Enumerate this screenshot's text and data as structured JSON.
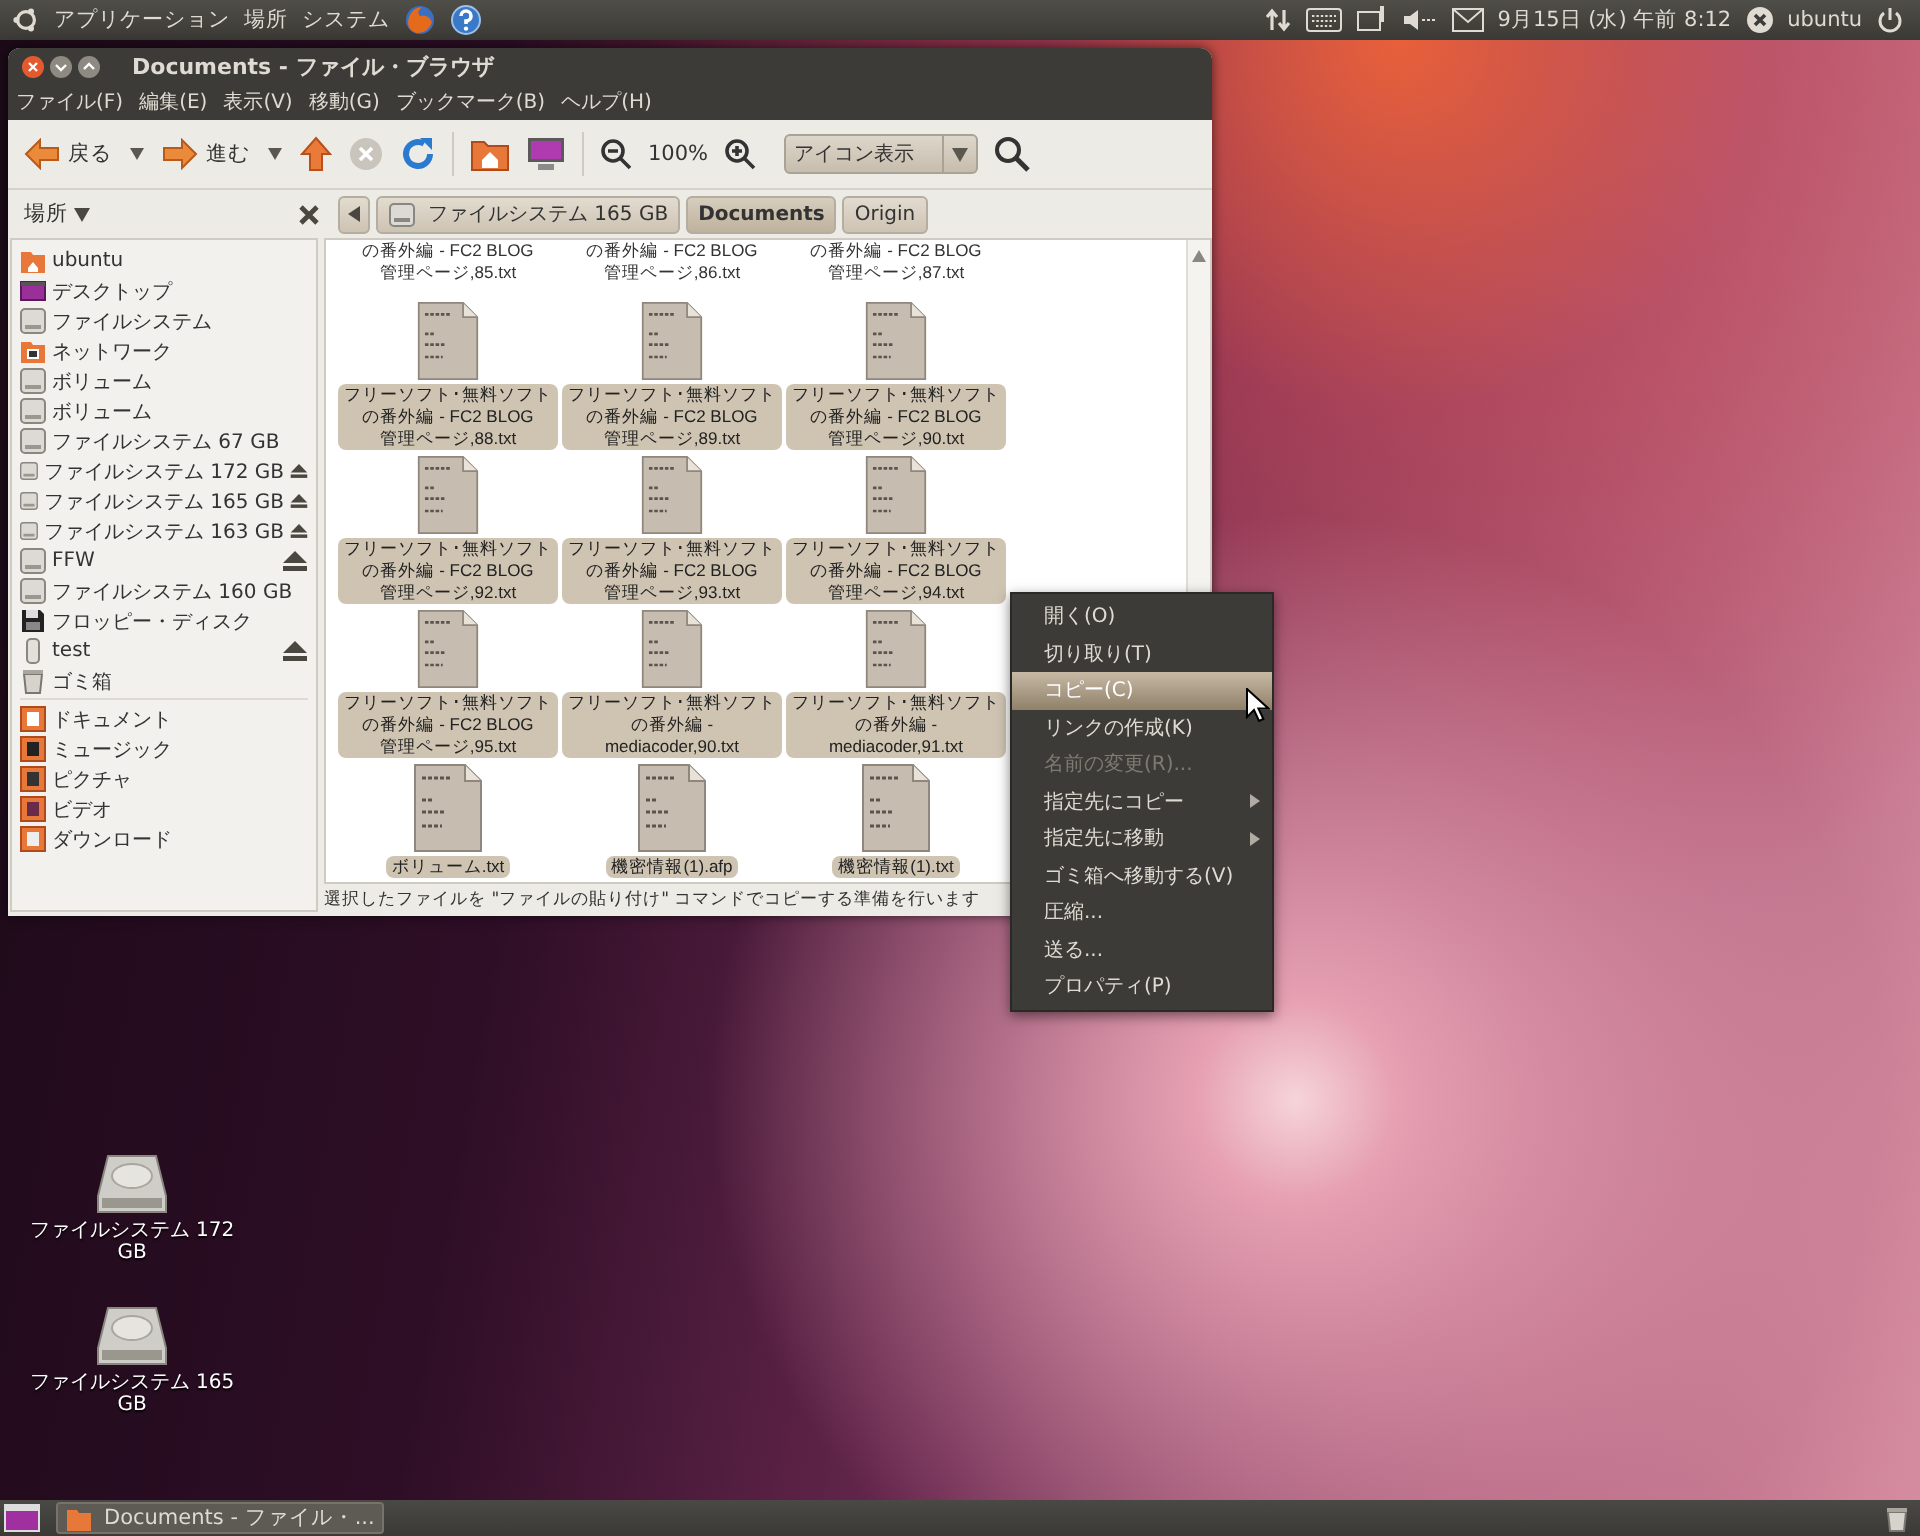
{
  "top_panel": {
    "menus": [
      "アプリケーション",
      "場所",
      "システム"
    ],
    "clock": "9月15日 (水) 午前 8:12",
    "user": "ubuntu"
  },
  "window": {
    "title": "Documents - ファイル・ブラウザ",
    "menu_bar": [
      "ファイル(F)",
      "編集(E)",
      "表示(V)",
      "移動(G)",
      "ブックマーク(B)",
      "ヘルプ(H)"
    ],
    "toolbar": {
      "back": "戻る",
      "forward": "進む",
      "stop_disabled": true,
      "zoom": "100%",
      "view_mode": "アイコン表示"
    },
    "sidebar": {
      "title": "場所",
      "places": [
        {
          "label": "ubuntu",
          "kind": "home",
          "eject": false
        },
        {
          "label": "デスクトップ",
          "kind": "desktop",
          "eject": false
        },
        {
          "label": "ファイルシステム",
          "kind": "drive",
          "eject": false
        },
        {
          "label": "ネットワーク",
          "kind": "network",
          "eject": false
        },
        {
          "label": "ボリューム",
          "kind": "drive",
          "eject": false
        },
        {
          "label": "ボリューム",
          "kind": "drive",
          "eject": false
        },
        {
          "label": "ファイルシステム 67 GB",
          "kind": "drive",
          "eject": false
        },
        {
          "label": "ファイルシステム 172 GB",
          "kind": "drive",
          "eject": true
        },
        {
          "label": "ファイルシステム 165 GB",
          "kind": "drive",
          "eject": true
        },
        {
          "label": "ファイルシステム 163 GB",
          "kind": "drive",
          "eject": true
        },
        {
          "label": "FFW",
          "kind": "drive",
          "eject": true
        },
        {
          "label": "ファイルシステム 160 GB",
          "kind": "drive",
          "eject": false
        },
        {
          "label": "フロッピー・ディスク",
          "kind": "floppy",
          "eject": false
        },
        {
          "label": "test",
          "kind": "usb",
          "eject": true
        },
        {
          "label": "ゴミ箱",
          "kind": "trash",
          "eject": false
        }
      ],
      "bookmarks": [
        {
          "label": "ドキュメント",
          "kind": "documents"
        },
        {
          "label": "ミュージック",
          "kind": "music"
        },
        {
          "label": "ピクチャ",
          "kind": "pictures"
        },
        {
          "label": "ビデオ",
          "kind": "video"
        },
        {
          "label": "ダウンロード",
          "kind": "download"
        }
      ]
    },
    "path": [
      {
        "label": "ファイルシステム 165 GB",
        "kind": "drive",
        "selected": false
      },
      {
        "label": "Documents",
        "kind": "folder",
        "selected": true
      },
      {
        "label": "Origin",
        "kind": "folder",
        "selected": false
      }
    ],
    "files": [
      {
        "lines": [
          "の番外編 - FC2 BLOG",
          "管理ページ,85.txt"
        ],
        "kind": "cut",
        "selected": false
      },
      {
        "lines": [
          "の番外編 - FC2 BLOG",
          "管理ページ,86.txt"
        ],
        "kind": "cut",
        "selected": false
      },
      {
        "lines": [
          "の番外編 - FC2 BLOG",
          "管理ページ,87.txt"
        ],
        "kind": "cut",
        "selected": false
      },
      {
        "lines": [
          "フリーソフト･無料ソフト",
          "の番外編 - FC2 BLOG",
          "管理ページ,88.txt"
        ],
        "kind": "text",
        "selected": true
      },
      {
        "lines": [
          "フリーソフト･無料ソフト",
          "の番外編 - FC2 BLOG",
          "管理ページ,89.txt"
        ],
        "kind": "text",
        "selected": true
      },
      {
        "lines": [
          "フリーソフト･無料ソフト",
          "の番外編 - FC2 BLOG",
          "管理ページ,90.txt"
        ],
        "kind": "text",
        "selected": true
      },
      {
        "lines": [
          "フリーソフト･無料ソフト",
          "の番外編 - FC2 BLOG",
          "管理ページ,92.txt"
        ],
        "kind": "text",
        "selected": true
      },
      {
        "lines": [
          "フリーソフト･無料ソフト",
          "の番外編 - FC2 BLOG",
          "管理ページ,93.txt"
        ],
        "kind": "text",
        "selected": true
      },
      {
        "lines": [
          "フリーソフト･無料ソフト",
          "の番外編 - FC2 BLOG",
          "管理ページ,94.txt"
        ],
        "kind": "text",
        "selected": true
      },
      {
        "lines": [
          "フリーソフト･無料ソフト",
          "の番外編 - FC2 BLOG",
          "管理ページ,95.txt"
        ],
        "kind": "text",
        "selected": true
      },
      {
        "lines": [
          "フリーソフト･無料ソフト",
          "の番外編 -",
          "mediacoder,90.txt"
        ],
        "kind": "text",
        "selected": true
      },
      {
        "lines": [
          "フリーソフト･無料ソフト",
          "の番外編 -",
          "mediacoder,91.txt"
        ],
        "kind": "text",
        "selected": true
      },
      {
        "lines": [
          "ボリューム.txt"
        ],
        "kind": "text",
        "selected": true
      },
      {
        "lines": [
          "機密情報(1).afp"
        ],
        "kind": "text",
        "selected": true
      },
      {
        "lines": [
          "機密情報(1).txt"
        ],
        "kind": "text",
        "selected": true
      }
    ],
    "status_bar": "選択したファイルを \"ファイルの貼り付け\" コマンドでコピーする準備を行います"
  },
  "context_menu": [
    {
      "label": "開く(O)",
      "disabled": false,
      "selected": false,
      "submenu": false
    },
    {
      "label": "切り取り(T)",
      "disabled": false,
      "selected": false,
      "submenu": false
    },
    {
      "label": "コピー(C)",
      "disabled": false,
      "selected": true,
      "submenu": false
    },
    {
      "label": "リンクの作成(K)",
      "disabled": false,
      "selected": false,
      "submenu": false
    },
    {
      "label": "名前の変更(R)...",
      "disabled": true,
      "selected": false,
      "submenu": false
    },
    {
      "label": "指定先にコピー",
      "disabled": false,
      "selected": false,
      "submenu": true
    },
    {
      "label": "指定先に移動",
      "disabled": false,
      "selected": false,
      "submenu": true
    },
    {
      "label": "ゴミ箱へ移動する(V)",
      "disabled": false,
      "selected": false,
      "submenu": false
    },
    {
      "label": "圧縮...",
      "disabled": false,
      "selected": false,
      "submenu": false
    },
    {
      "label": "送る...",
      "disabled": false,
      "selected": false,
      "submenu": false
    },
    {
      "label": "プロパティ(P)",
      "disabled": false,
      "selected": false,
      "submenu": false
    }
  ],
  "desktop_icons": [
    {
      "lines": [
        "ファイルシステム 172",
        "GB"
      ]
    },
    {
      "lines": [
        "ファイルシステム 165",
        "GB"
      ]
    }
  ],
  "taskbar": {
    "task": "Documents - ファイル・..."
  }
}
